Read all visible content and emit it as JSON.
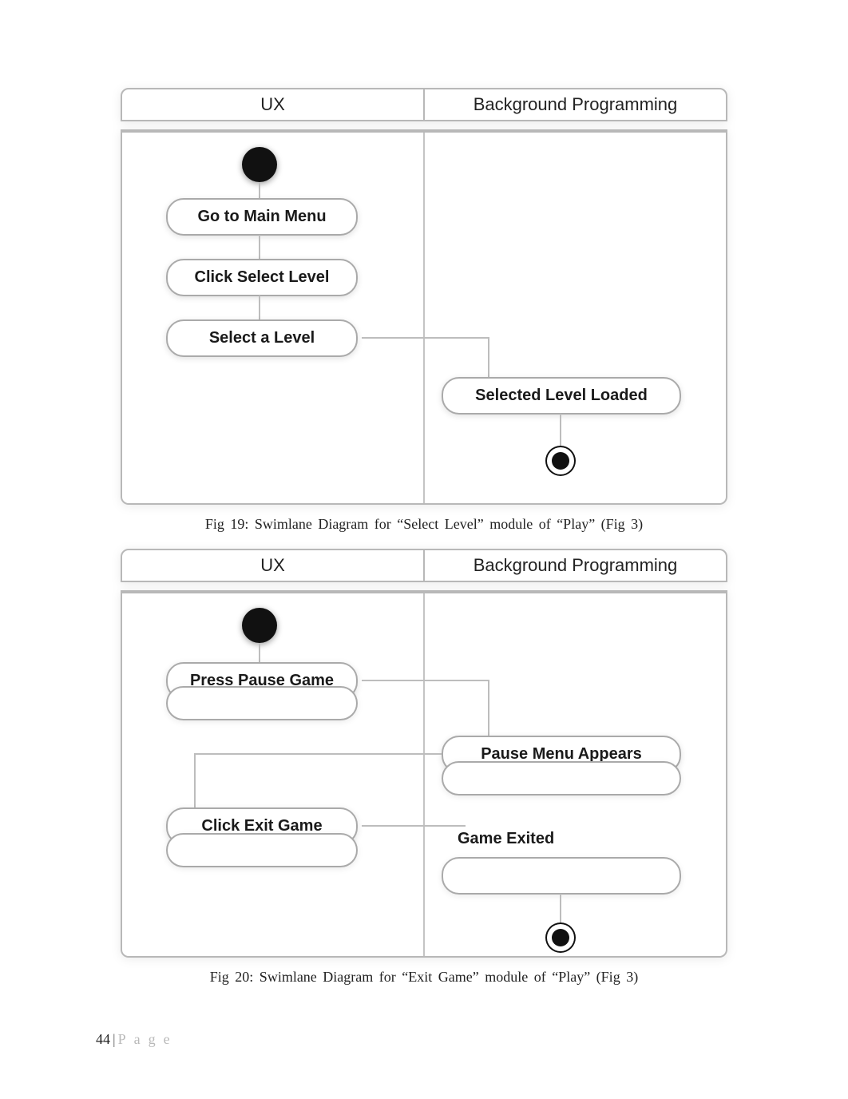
{
  "diagrams": [
    {
      "lanes": {
        "left": "UX",
        "right": "Background Programming"
      },
      "steps": {
        "start": true,
        "ux1": "Go to Main Menu",
        "ux2": "Click Select Level",
        "ux3": "Select a Level",
        "bg1": "Selected Level Loaded",
        "end": true
      },
      "caption": "Fig  19: Swimlane  Diagram  for  “Select  Level”  module  of “Play”  (Fig 3)"
    },
    {
      "lanes": {
        "left": "UX",
        "right": "Background Programming"
      },
      "steps": {
        "start": true,
        "ux1": "Press Pause Game",
        "bg1": "Pause Menu Appears",
        "ux2": "Click Exit Game",
        "bg2": "Game Exited",
        "end": true
      },
      "caption": "Fig  20: Swimlane  Diagram  for  “Exit  Game”  module  of “Play”  (Fig 3)"
    }
  ],
  "footer": {
    "page_number": "44",
    "label": "Page"
  }
}
